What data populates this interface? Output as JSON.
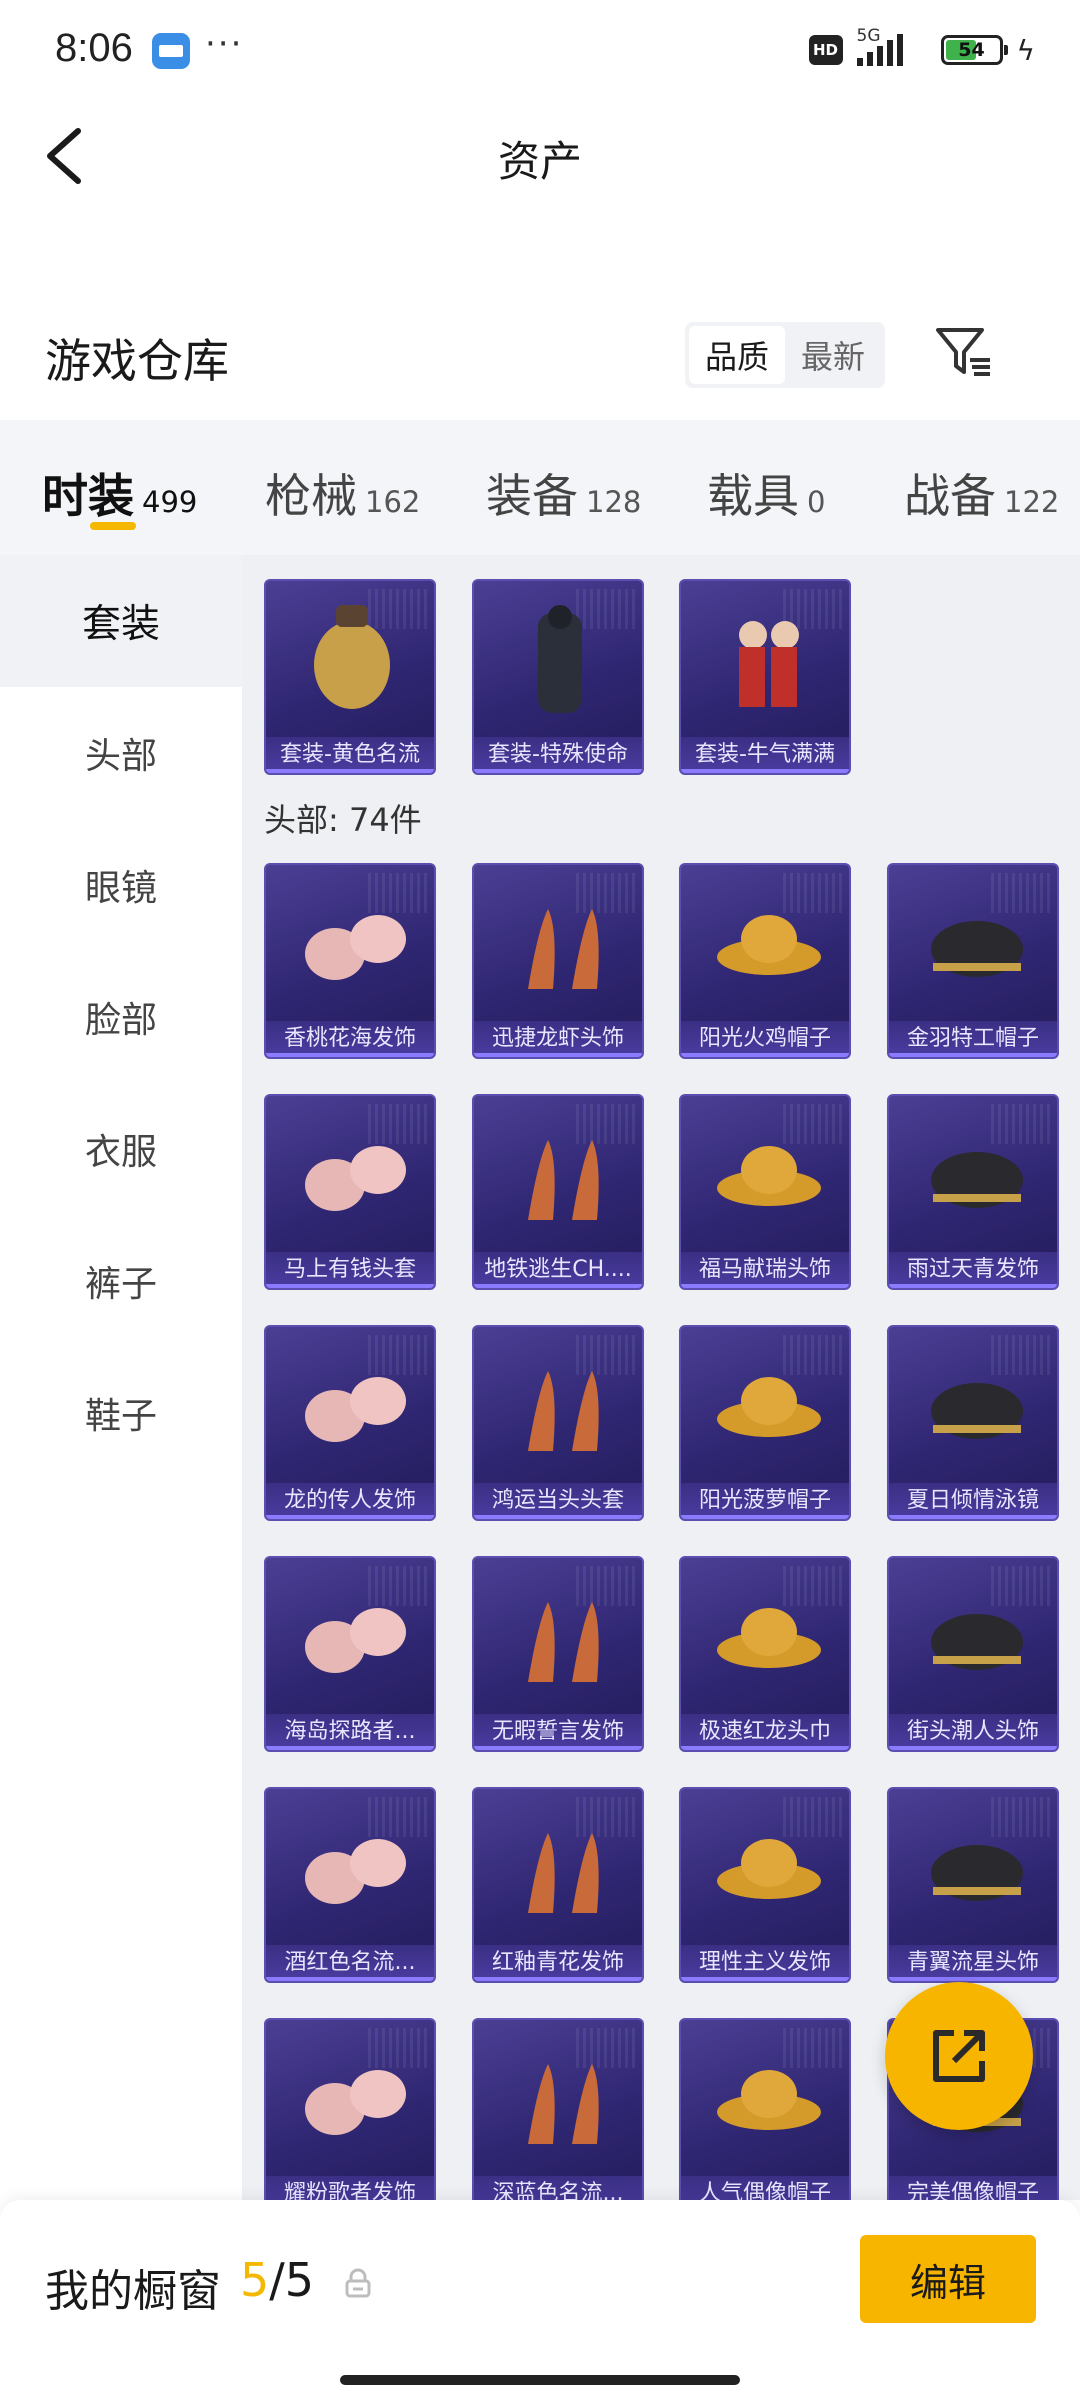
{
  "status": {
    "time": "8:06",
    "more": "···",
    "hd": "HD",
    "network": "5G",
    "battery": "54"
  },
  "header": {
    "title": "资产"
  },
  "warehouse": {
    "title": "游戏仓库",
    "sort_options": [
      "品质",
      "最新"
    ],
    "sort_active": "品质"
  },
  "categories": [
    {
      "name": "时装",
      "count": "499"
    },
    {
      "name": "枪械",
      "count": "162"
    },
    {
      "name": "装备",
      "count": "128"
    },
    {
      "name": "载具",
      "count": "0"
    },
    {
      "name": "战备",
      "count": "122"
    }
  ],
  "side_menu": [
    "套装",
    "头部",
    "眼镜",
    "脸部",
    "衣服",
    "裤子",
    "鞋子"
  ],
  "suits": [
    "套装-黄色名流",
    "套装-特殊使命",
    "套装-牛气满满"
  ],
  "head_section": {
    "label": "头部: 74件"
  },
  "head_items": [
    "香桃花海发饰",
    "迅捷龙虾头饰",
    "阳光火鸡帽子",
    "金羽特工帽子",
    "马上有钱头套",
    "地铁逃生CH....",
    "福马献瑞头饰",
    "雨过天青发饰",
    "龙的传人发饰",
    "鸿运当头头套",
    "阳光菠萝帽子",
    "夏日倾情泳镜",
    "海岛探路者...",
    "无暇誓言发饰",
    "极速红龙头巾",
    "街头潮人头饰",
    "酒红色名流...",
    "红釉青花发饰",
    "理性主义发饰",
    "青翼流星头饰",
    "耀粉歌者发饰",
    "深蓝色名流...",
    "人气偶像帽子",
    "完美偶像帽子"
  ],
  "showcase": {
    "title": "我的橱窗",
    "current": "5",
    "total": "/5",
    "edit": "编辑"
  }
}
